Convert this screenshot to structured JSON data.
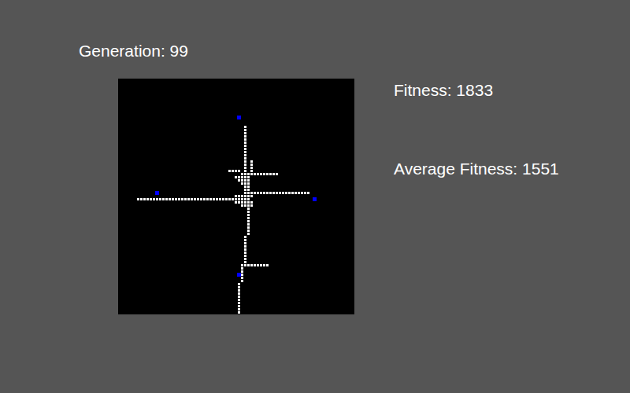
{
  "generation_label": "Generation: 99",
  "fitness": "Fitness: 1833",
  "average_fitness": "Average Fitness: 1551",
  "board": {
    "paths": [
      [
        40,
        15,
        40,
        37
      ],
      [
        6,
        38,
        41,
        38
      ],
      [
        35,
        29,
        38,
        29
      ],
      [
        39,
        30,
        50,
        30
      ],
      [
        42,
        26,
        42,
        29
      ],
      [
        37,
        31,
        41,
        31
      ],
      [
        38,
        32,
        41,
        32
      ],
      [
        39,
        33,
        41,
        33
      ],
      [
        40,
        34,
        41,
        34
      ],
      [
        41,
        35,
        41,
        36
      ],
      [
        42,
        36,
        60,
        36
      ],
      [
        37,
        37,
        42,
        37
      ],
      [
        37,
        39,
        42,
        39
      ],
      [
        39,
        40,
        42,
        40
      ],
      [
        41,
        41,
        41,
        49
      ],
      [
        40,
        50,
        40,
        58
      ],
      [
        39,
        59,
        47,
        59
      ],
      [
        39,
        60,
        39,
        64
      ],
      [
        38,
        65,
        38,
        74
      ]
    ],
    "targets": [
      [
        38,
        12
      ],
      [
        12,
        36
      ],
      [
        62,
        38
      ],
      [
        38,
        62
      ]
    ]
  }
}
